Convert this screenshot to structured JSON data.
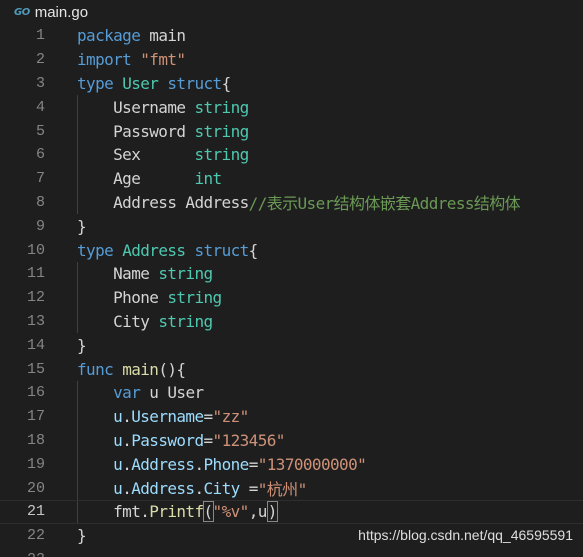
{
  "tab": {
    "icon": "go-logo-icon",
    "icon_text": "GO",
    "filename": "main.go"
  },
  "lines": [
    {
      "n": "1",
      "tokens": [
        [
          "kw",
          "package"
        ],
        [
          "pl",
          " "
        ],
        [
          "pl",
          "main"
        ]
      ]
    },
    {
      "n": "2",
      "tokens": [
        [
          "kw",
          "import"
        ],
        [
          "pl",
          " "
        ],
        [
          "str",
          "\"fmt\""
        ]
      ]
    },
    {
      "n": "3",
      "tokens": [
        [
          "kw",
          "type"
        ],
        [
          "pl",
          " "
        ],
        [
          "ty",
          "User"
        ],
        [
          "pl",
          " "
        ],
        [
          "kw",
          "struct"
        ],
        [
          "pl",
          "{"
        ]
      ]
    },
    {
      "n": "4",
      "tokens": [
        [
          "pl",
          "    "
        ],
        [
          "pl",
          "Username"
        ],
        [
          "pl",
          " "
        ],
        [
          "ty",
          "string"
        ]
      ]
    },
    {
      "n": "5",
      "tokens": [
        [
          "pl",
          "    "
        ],
        [
          "pl",
          "Password"
        ],
        [
          "pl",
          " "
        ],
        [
          "ty",
          "string"
        ]
      ]
    },
    {
      "n": "6",
      "tokens": [
        [
          "pl",
          "    "
        ],
        [
          "pl",
          "Sex"
        ],
        [
          "pl",
          "      "
        ],
        [
          "ty",
          "string"
        ]
      ]
    },
    {
      "n": "7",
      "tokens": [
        [
          "pl",
          "    "
        ],
        [
          "pl",
          "Age"
        ],
        [
          "pl",
          "      "
        ],
        [
          "ty",
          "int"
        ]
      ]
    },
    {
      "n": "8",
      "tokens": [
        [
          "pl",
          "    "
        ],
        [
          "pl",
          "Address"
        ],
        [
          "pl",
          " "
        ],
        [
          "pl",
          "Address"
        ],
        [
          "cm",
          "//表示User结构体嵌套Address结构体"
        ]
      ]
    },
    {
      "n": "9",
      "tokens": [
        [
          "pl",
          "}"
        ]
      ]
    },
    {
      "n": "10",
      "tokens": [
        [
          "kw",
          "type"
        ],
        [
          "pl",
          " "
        ],
        [
          "ty",
          "Address"
        ],
        [
          "pl",
          " "
        ],
        [
          "kw",
          "struct"
        ],
        [
          "pl",
          "{"
        ]
      ]
    },
    {
      "n": "11",
      "tokens": [
        [
          "pl",
          "    "
        ],
        [
          "pl",
          "Name"
        ],
        [
          "pl",
          " "
        ],
        [
          "ty",
          "string"
        ]
      ]
    },
    {
      "n": "12",
      "tokens": [
        [
          "pl",
          "    "
        ],
        [
          "pl",
          "Phone"
        ],
        [
          "pl",
          " "
        ],
        [
          "ty",
          "string"
        ]
      ]
    },
    {
      "n": "13",
      "tokens": [
        [
          "pl",
          "    "
        ],
        [
          "pl",
          "City"
        ],
        [
          "pl",
          " "
        ],
        [
          "ty",
          "string"
        ]
      ]
    },
    {
      "n": "14",
      "tokens": [
        [
          "pl",
          "}"
        ]
      ]
    },
    {
      "n": "15",
      "tokens": [
        [
          "kw",
          "func"
        ],
        [
          "pl",
          " "
        ],
        [
          "fn",
          "main"
        ],
        [
          "pl",
          "(){"
        ]
      ]
    },
    {
      "n": "16",
      "tokens": [
        [
          "pl",
          "    "
        ],
        [
          "kw",
          "var"
        ],
        [
          "pl",
          " "
        ],
        [
          "pl",
          "u"
        ],
        [
          "pl",
          " "
        ],
        [
          "pl",
          "User"
        ]
      ]
    },
    {
      "n": "17",
      "tokens": [
        [
          "pl",
          "    "
        ],
        [
          "id",
          "u"
        ],
        [
          "pl",
          "."
        ],
        [
          "id",
          "Username"
        ],
        [
          "pl",
          "="
        ],
        [
          "str",
          "\"zz\""
        ]
      ]
    },
    {
      "n": "18",
      "tokens": [
        [
          "pl",
          "    "
        ],
        [
          "id",
          "u"
        ],
        [
          "pl",
          "."
        ],
        [
          "id",
          "Password"
        ],
        [
          "pl",
          "="
        ],
        [
          "str",
          "\"123456\""
        ]
      ]
    },
    {
      "n": "19",
      "tokens": [
        [
          "pl",
          "    "
        ],
        [
          "id",
          "u"
        ],
        [
          "pl",
          "."
        ],
        [
          "id",
          "Address"
        ],
        [
          "pl",
          "."
        ],
        [
          "id",
          "Phone"
        ],
        [
          "pl",
          "="
        ],
        [
          "str",
          "\"1370000000\""
        ]
      ]
    },
    {
      "n": "20",
      "tokens": [
        [
          "pl",
          "    "
        ],
        [
          "id",
          "u"
        ],
        [
          "pl",
          "."
        ],
        [
          "id",
          "Address"
        ],
        [
          "pl",
          "."
        ],
        [
          "id",
          "City"
        ],
        [
          "pl",
          " ="
        ],
        [
          "str",
          "\"杭州\""
        ]
      ]
    },
    {
      "n": "21",
      "tokens": [
        [
          "pl",
          "    "
        ],
        [
          "pl",
          "fmt"
        ],
        [
          "pl",
          "."
        ],
        [
          "fn",
          "Printf"
        ],
        [
          "pl",
          "("
        ],
        [
          "str",
          "\"%v\""
        ],
        [
          "pl",
          ","
        ],
        [
          "pl",
          "u"
        ],
        [
          "pl",
          ")"
        ]
      ],
      "active": true
    },
    {
      "n": "22",
      "tokens": [
        [
          "pl",
          "}"
        ]
      ]
    },
    {
      "n": "23",
      "tokens": []
    }
  ],
  "watermark": "https://blog.csdn.net/qq_46595591",
  "colors": {
    "background": "#1e1e1e",
    "keyword": "#569cd6",
    "type": "#4ec9b0",
    "string": "#ce9178",
    "comment": "#6a9955",
    "function": "#dcdcaa",
    "identifier": "#9cdcfe",
    "line_number": "#858585"
  }
}
